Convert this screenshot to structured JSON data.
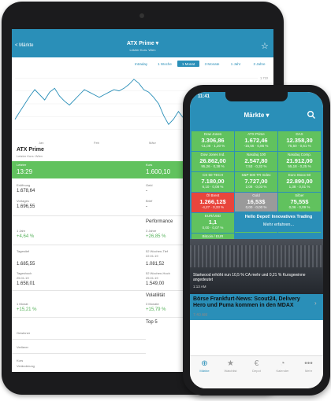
{
  "ipad": {
    "nav": {
      "back": "< Märkte",
      "title": "ATX Prime ▾",
      "subtitle": "Letzter Kurs: Wien",
      "star": "☆"
    },
    "ranges": [
      "Intraday",
      "1 Woche",
      "1 Monat",
      "3 Monate",
      "1 Jahr",
      "3 Jahre"
    ],
    "active_range": "1 Monat",
    "y_ticks": [
      "1.710",
      "1.700",
      "1.690",
      "1.680",
      "1.670"
    ],
    "x_ticks": [
      "Jan",
      "Feb",
      "März",
      "Apr"
    ],
    "chart_line": [
      1678,
      1684,
      1690,
      1696,
      1701,
      1697,
      1693,
      1699,
      1702,
      1696,
      1692,
      1689,
      1693,
      1697,
      1701,
      1699,
      1697,
      1695,
      1697,
      1699,
      1701,
      1700,
      1702,
      1705,
      1709,
      1706,
      1701,
      1699,
      1695,
      1690,
      1681,
      1674,
      1678,
      1684,
      1679,
      1675,
      1680,
      1685,
      1688,
      1684,
      1681,
      1684,
      1687,
      1689,
      1685,
      1679,
      1676,
      1673,
      1677,
      1684
    ],
    "index_title": "ATX Prime",
    "index_sub": "Letzter Kurs: Wien",
    "green_bar": {
      "left_label": "Letzter",
      "left_value": "13:29",
      "right_label": "Kurs",
      "right_value": "1.600,10"
    },
    "rows": {
      "eroeffnung_label": "Eröffnung",
      "eroeffnung_value": "1.678,64",
      "geld_label": "Geld",
      "geld_value": "-",
      "vortag_label": "Vortages",
      "vortag_value": "1.696,55",
      "brief_label": "Brief",
      "brief_value": "-",
      "performance_header": "Performance",
      "perf1_label": "1 Jahr",
      "perf1_value": "+4,64 %",
      "perf2_label": "3 Jahre",
      "perf2_value": "+26,85 %",
      "tief_label": "Tagestief",
      "tief_value": "1.685,55",
      "w52t_label": "52 Wochen-Tief",
      "w52t_date": "22.01.19",
      "w52t_value": "1.081,52",
      "hoch_label": "Tageshoch",
      "hoch_date": "25.01.19",
      "hoch_value": "1.658,01",
      "w52h_label": "52 Wochen-Hoch",
      "w52h_date": "25.01.19",
      "w52h_value": "1.549,00",
      "volat_header": "Volatilität",
      "vol1_label": "1 Monat",
      "vol1_value": "+15,21 %",
      "vol2_label": "3 Monate",
      "vol2_value": "+15,79 %",
      "top_header": "Top 5",
      "gewinner_label": "Gewinner",
      "verlierer_label": "Verlierer",
      "kurs_label": "Kurs",
      "bottom_text": "Veränderung"
    }
  },
  "iphone": {
    "time": "11:41",
    "title": "Märkte ▾",
    "tiles": [
      {
        "name": "Dow Jones",
        "value": "3.306,86",
        "change": "-11,08 · 1,20 %",
        "color": "g"
      },
      {
        "name": "ATX Prime",
        "value": "1.672,46",
        "change": "-15,56 · 0,86 %",
        "color": "g"
      },
      {
        "name": "DAX",
        "value": "12.358,30",
        "change": "75,50 · 0,61 %",
        "color": "g"
      },
      {
        "name": "Dow Jones Ind.",
        "value": "26.862,00",
        "change": "95,26 · 0,38 %",
        "color": "g"
      },
      {
        "name": "Nasdaq 100",
        "value": "2.547,80",
        "change": "7,53 · 0,32 %",
        "color": "g"
      },
      {
        "name": "Nasdaq Comp.",
        "value": "21.912,00",
        "change": "55,18 · 0,25 %",
        "color": "g"
      },
      {
        "name": "CS 50 TECH",
        "value": "7.180,00",
        "change": "6,10 · 0,08 %",
        "color": "g"
      },
      {
        "name": "S&P 500 TR Index",
        "value": "7.727,00",
        "change": "2,08 · 0,03 %",
        "color": "g"
      },
      {
        "name": "Euro Stoxx 50",
        "value": "22.890,00",
        "change": "1,38 · 0,01 %",
        "color": "g"
      },
      {
        "name": "Öl Brent",
        "value": "1.266,12$",
        "change": "-4,27 · 0,33 %",
        "color": "r"
      },
      {
        "name": "Gold",
        "value": "16,53$",
        "change": "0,00 · 0,00 %",
        "color": "gr"
      },
      {
        "name": "Silber",
        "value": "75,55$",
        "change": "0,06 · 0,09 %",
        "color": "g"
      },
      {
        "name": "EUR/USD",
        "value": "1,1",
        "change": "0,00 · 0,07 %",
        "color": "g"
      },
      {
        "name": "EUR/CHF",
        "value": "1,15",
        "change": "0,00 · 0,10 %",
        "color": "g"
      },
      {
        "name": "EUR/GBP",
        "value": "0,8",
        "change": "0,00 · 0,04 %",
        "color": "g"
      },
      {
        "name": "Bitcoin / EUR",
        "value": "-0,16",
        "change": "0,00 · 0,40 %",
        "color": "g"
      }
    ],
    "promo": {
      "title": "Hello Depot! Innovatives Trading",
      "link": "Mehr erfahren..."
    },
    "news1": {
      "headline": "Startwood erhöht nun 10,5 % CA mehr und 0,21 % Kursgewinne angedeutet",
      "time": "1:13 AM"
    },
    "news2": {
      "headline": "Börse Frankfurt-News: Scout24, Delivery Hero und Puma kommen in den MDAX",
      "time": "7:40 AM"
    },
    "tabs": [
      {
        "icon": "⊕",
        "label": "Märkte"
      },
      {
        "icon": "★",
        "label": "Watchlist"
      },
      {
        "icon": "€",
        "label": "Depot"
      },
      {
        "icon": "◔",
        "label": "Kalender"
      },
      {
        "icon": "•••",
        "label": "Mehr"
      }
    ],
    "colors": {
      "brand": "#2a8fb8",
      "up": "#61c25e",
      "down": "#e8453c",
      "flat": "#9a9a9a"
    }
  }
}
